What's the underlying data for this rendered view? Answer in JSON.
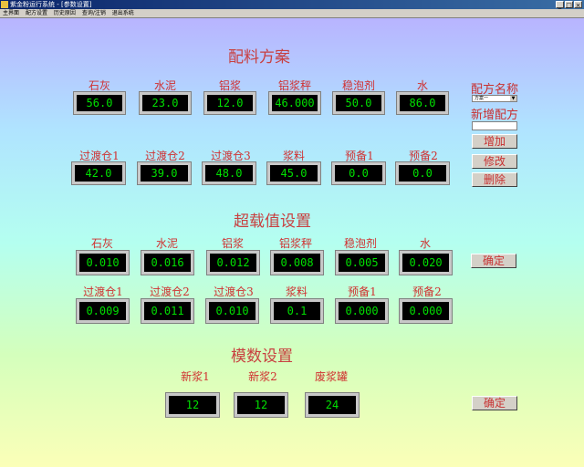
{
  "window": {
    "title": "紫金粉运行系统 - [参数设置]",
    "min": "_",
    "max": "□",
    "close": "×"
  },
  "menu": [
    "主界面",
    "配方设置",
    "历史原因",
    "查询/注销",
    "退出系统"
  ],
  "recipe": {
    "title": "配料方案",
    "row1": [
      {
        "label": "石灰",
        "value": "56.0"
      },
      {
        "label": "水泥",
        "value": "23.0"
      },
      {
        "label": "铝浆",
        "value": "12.0"
      },
      {
        "label": "铝浆秤",
        "value": "46.000"
      },
      {
        "label": "稳泡剂",
        "value": "50.0"
      },
      {
        "label": "水",
        "value": "86.0"
      }
    ],
    "row2": [
      {
        "label": "过渡仓1",
        "value": "42.0"
      },
      {
        "label": "过渡仓2",
        "value": "39.0"
      },
      {
        "label": "过渡仓3",
        "value": "48.0"
      },
      {
        "label": "浆料",
        "value": "45.0"
      },
      {
        "label": "预备1",
        "value": "0.0"
      },
      {
        "label": "预备2",
        "value": "0.0"
      }
    ]
  },
  "side": {
    "recipe_name_label": "配方名称",
    "recipe_select": "方案一",
    "new_recipe_label": "新增配方",
    "add_button": "增加",
    "modify_button": "修改",
    "delete_button": "删除"
  },
  "overload": {
    "title": "超载值设置",
    "row1": [
      {
        "label": "石灰",
        "value": "0.010"
      },
      {
        "label": "水泥",
        "value": "0.016"
      },
      {
        "label": "铝浆",
        "value": "0.012"
      },
      {
        "label": "铝浆秤",
        "value": "0.008"
      },
      {
        "label": "稳泡剂",
        "value": "0.005"
      },
      {
        "label": "水",
        "value": "0.020"
      }
    ],
    "row2": [
      {
        "label": "过渡仓1",
        "value": "0.009"
      },
      {
        "label": "过渡仓2",
        "value": "0.011"
      },
      {
        "label": "过渡仓3",
        "value": "0.010"
      },
      {
        "label": "浆料",
        "value": "0.1"
      },
      {
        "label": "预备1",
        "value": "0.000"
      },
      {
        "label": "预备2",
        "value": "0.000"
      }
    ],
    "confirm_button": "确定"
  },
  "mold": {
    "title": "模数设置",
    "items": [
      {
        "label": "新浆1",
        "value": "12"
      },
      {
        "label": "新浆2",
        "value": "12"
      },
      {
        "label": "废浆罐",
        "value": "24"
      }
    ],
    "confirm_button": "确定"
  }
}
